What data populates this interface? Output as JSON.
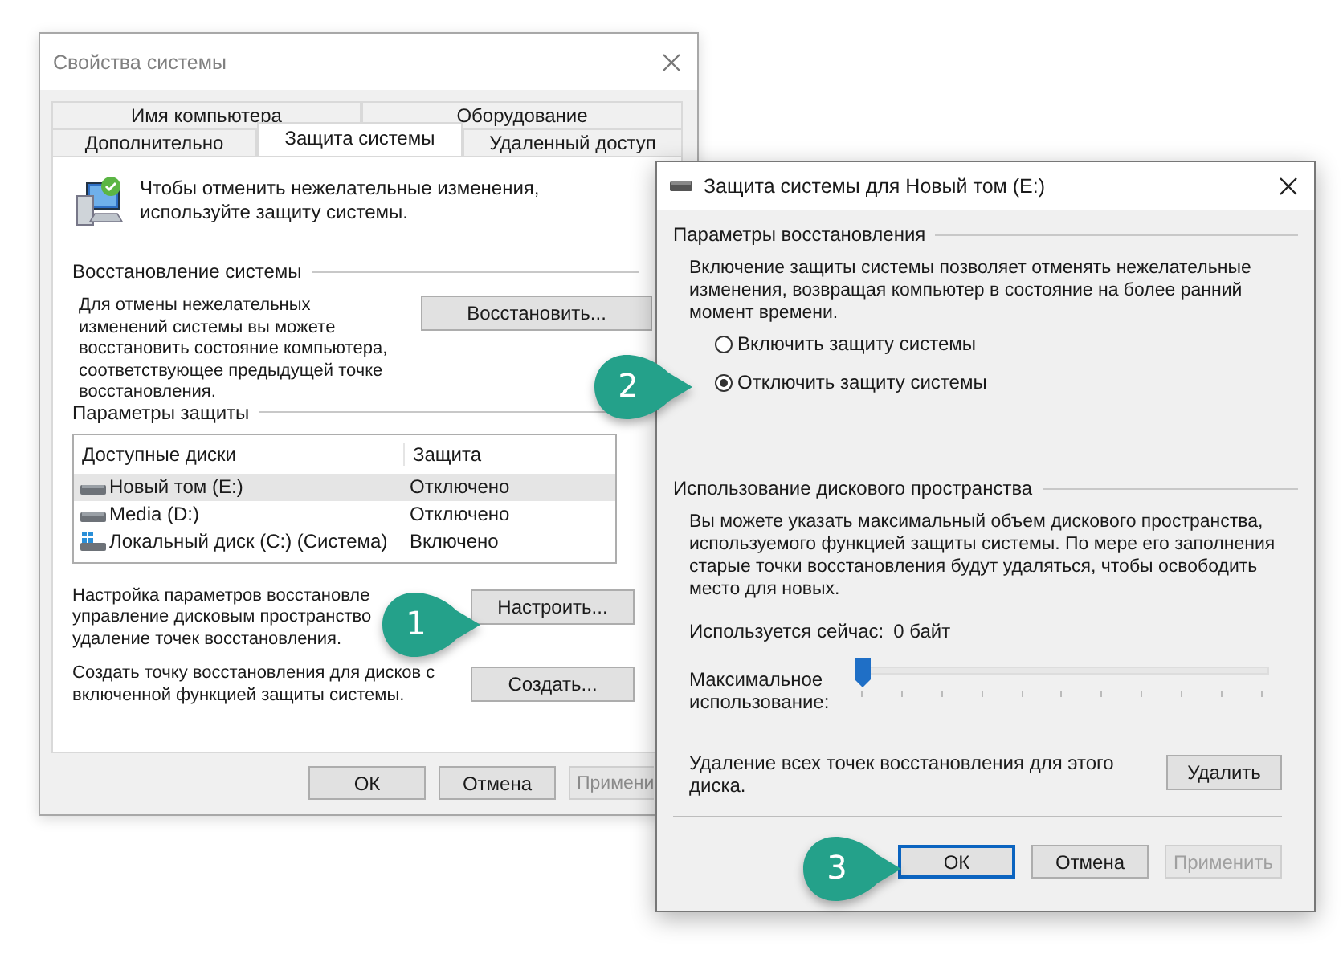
{
  "system_properties": {
    "title": "Свойства системы",
    "tab_rows": [
      [
        {
          "label": "Имя компьютера",
          "selected": false
        },
        {
          "label": "Оборудование",
          "selected": false
        }
      ],
      [
        {
          "label": "Дополнительно",
          "selected": false
        },
        {
          "label": "Защита системы",
          "selected": true
        },
        {
          "label": "Удаленный доступ",
          "selected": false
        }
      ]
    ],
    "intro": "Чтобы отменить нежелательные изменения, используйте защиту системы.",
    "restore_group": {
      "title": "Восстановление системы",
      "text": "Для отмены нежелательных изменений системы вы можете восстановить состояние компьютера, соответствующее предыдущей точке восстановления.",
      "button": "Восстановить..."
    },
    "protection_group": {
      "title": "Параметры защиты",
      "columns": [
        "Доступные диски",
        "Защита"
      ],
      "rows": [
        {
          "name": "Новый том (E:)",
          "protection": "Отключено",
          "kind": "drive",
          "selected": true
        },
        {
          "name": "Media (D:)",
          "protection": "Отключено",
          "kind": "drive",
          "selected": false
        },
        {
          "name": "Локальный диск (C:) (Система)",
          "protection": "Включено",
          "kind": "system",
          "selected": false
        }
      ]
    },
    "configure": {
      "lines": [
        "Настройка параметров восстановле",
        "управление дисковым пространство",
        "удаление точек восстановления."
      ],
      "button": "Настроить..."
    },
    "create": {
      "text": "Создать точку восстановления для дисков с включенной функцией защиты системы.",
      "button": "Создать..."
    },
    "buttons": [
      {
        "label": "ОК",
        "disabled": false
      },
      {
        "label": "Отмена",
        "disabled": false
      },
      {
        "label": "Примени",
        "disabled": true
      }
    ]
  },
  "drive_protection": {
    "title": "Защита системы для Новый том (E:)",
    "recovery": {
      "title": "Параметры восстановления",
      "text": "Включение защиты системы позволяет отменять нежелательные изменения, возвращая компьютер в состояние на более ранний момент времени.",
      "options": [
        {
          "label": "Включить защиту системы",
          "selected": false
        },
        {
          "label": "Отключить защиту системы",
          "selected": true
        }
      ]
    },
    "disk": {
      "title": "Использование дискового пространства",
      "text": "Вы можете указать максимальный объем дискового пространства, используемого функцией защиты системы. По мере его заполнения старые точки восстановления будут удаляться, чтобы освободить место для новых.",
      "usage_label": "Используется сейчас:",
      "usage_value": "0 байт",
      "max_label": "Максимальное использование:",
      "level": 0,
      "delete_text": "Удаление всех точек восстановления для этого диска.",
      "delete_button": "Удалить"
    },
    "buttons": [
      {
        "label": "ОК",
        "default": true,
        "disabled": false
      },
      {
        "label": "Отмена",
        "default": false,
        "disabled": false
      },
      {
        "label": "Применить",
        "default": false,
        "disabled": true
      }
    ]
  },
  "callouts": [
    {
      "label": "1"
    },
    {
      "label": "2"
    },
    {
      "label": "3"
    }
  ]
}
